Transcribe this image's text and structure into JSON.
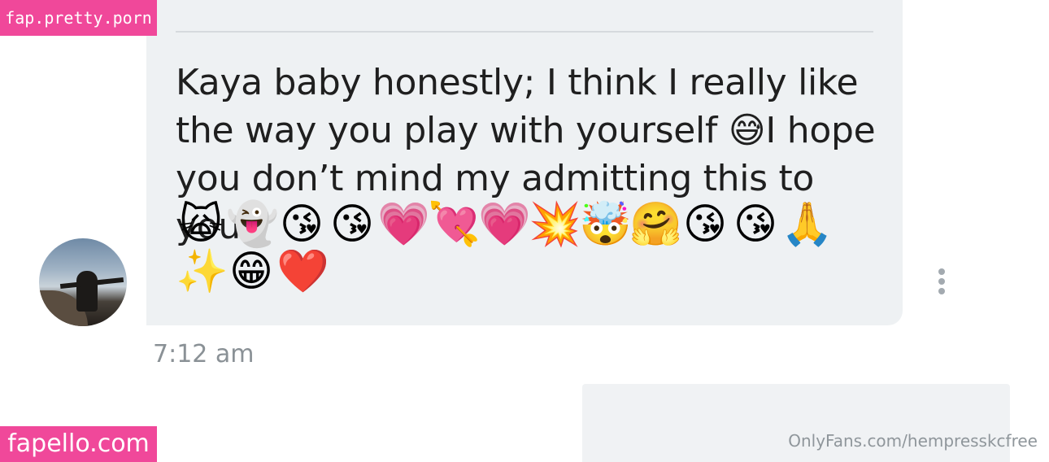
{
  "message": {
    "text": "Kaya baby honestly; I think I really like the way you play with yourself 😅I hope you don’t mind my admitting this to you",
    "emojis": [
      "🙀",
      "👻",
      "😘",
      "😘",
      "💗",
      "💘",
      "💗",
      "💥",
      "🤯",
      "🤗",
      "😘",
      "😘",
      "🙏",
      "✨",
      "😁",
      "❤️"
    ],
    "timestamp": "7:12 am"
  },
  "sender": {
    "avatar_icon": "avatar-photo"
  },
  "actions": {
    "more_icon": "vertical-ellipsis-icon"
  },
  "watermarks": {
    "top": "fap.pretty.porn",
    "bottom": "fapello.com",
    "credit": "OnlyFans.com/hempresskcfree"
  },
  "colors": {
    "bubble": "#eef1f3",
    "accent": "#00aff0",
    "watermark": "#f0489a",
    "timestamp": "#8a9196"
  }
}
